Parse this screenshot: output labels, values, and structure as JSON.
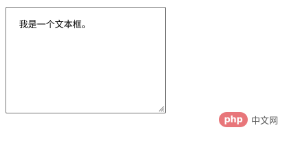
{
  "textarea": {
    "value": "我是一个文本框。"
  },
  "watermark": {
    "php_text": "php",
    "cn_text": "中文网"
  },
  "colors": {
    "php_logo_bg": "#e8767a",
    "textarea_border": "#767676"
  }
}
